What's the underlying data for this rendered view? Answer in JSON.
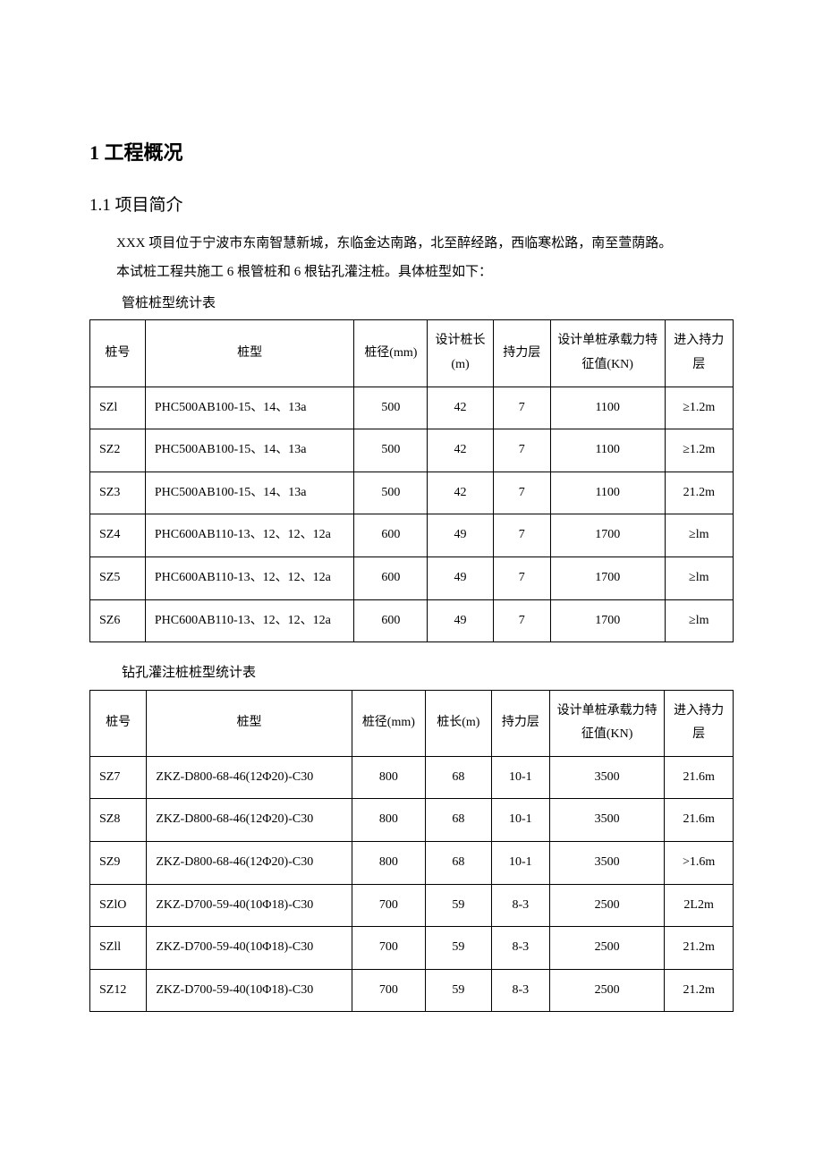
{
  "h1": "1 工程概况",
  "h2": "1.1 项目简介",
  "p1": "XXX 项目位于宁波市东南智慧新城，东临金达南路，北至醉经路，西临寒松路，南至萱荫路。",
  "p2": "本试桩工程共施工 6 根管桩和 6 根钻孔灌注桩。具体桩型如下：",
  "t1_caption": "管桩桩型统计表",
  "t1_head": {
    "c1": "桩号",
    "c2": "桩型",
    "c3": "桩径(mm)",
    "c4": "设计桩长(m)",
    "c5": "持力层",
    "c6": "设计单桩承载力特征值(KN)",
    "c7": "进入持力层"
  },
  "t1_rows": [
    {
      "c1": "SZl",
      "c2": "PHC500AB100-15、14、13a",
      "c3": "500",
      "c4": "42",
      "c5": "7",
      "c6": "1100",
      "c7": "≥1.2m"
    },
    {
      "c1": "SZ2",
      "c2": "PHC500AB100-15、14、13a",
      "c3": "500",
      "c4": "42",
      "c5": "7",
      "c6": "1100",
      "c7": "≥1.2m"
    },
    {
      "c1": "SZ3",
      "c2": "PHC500AB100-15、14、13a",
      "c3": "500",
      "c4": "42",
      "c5": "7",
      "c6": "1100",
      "c7": "21.2m"
    },
    {
      "c1": "SZ4",
      "c2": "PHC600AB110-13、12、12、12a",
      "c3": "600",
      "c4": "49",
      "c5": "7",
      "c6": "1700",
      "c7": "≥lm"
    },
    {
      "c1": "SZ5",
      "c2": "PHC600AB110-13、12、12、12a",
      "c3": "600",
      "c4": "49",
      "c5": "7",
      "c6": "1700",
      "c7": "≥lm"
    },
    {
      "c1": "SZ6",
      "c2": "PHC600AB110-13、12、12、12a",
      "c3": "600",
      "c4": "49",
      "c5": "7",
      "c6": "1700",
      "c7": "≥lm"
    }
  ],
  "t2_caption": "钻孔灌注桩桩型统计表",
  "t2_head": {
    "c1": "桩号",
    "c2": "桩型",
    "c3": "桩径(mm)",
    "c4": "桩长(m)",
    "c5": "持力层",
    "c6": "设计单桩承载力特征值(KN)",
    "c7": "进入持力层"
  },
  "t2_rows": [
    {
      "c1": "SZ7",
      "c2": "ZKZ-D800-68-46(12Φ20)-C30",
      "c3": "800",
      "c4": "68",
      "c5": "10-1",
      "c6": "3500",
      "c7": "21.6m"
    },
    {
      "c1": "SZ8",
      "c2": "ZKZ-D800-68-46(12Φ20)-C30",
      "c3": "800",
      "c4": "68",
      "c5": "10-1",
      "c6": "3500",
      "c7": "21.6m"
    },
    {
      "c1": "SZ9",
      "c2": "ZKZ-D800-68-46(12Φ20)-C30",
      "c3": "800",
      "c4": "68",
      "c5": "10-1",
      "c6": "3500",
      "c7": ">1.6m"
    },
    {
      "c1": "SZlO",
      "c2": "ZKZ-D700-59-40(10Φ18)-C30",
      "c3": "700",
      "c4": "59",
      "c5": "8-3",
      "c6": "2500",
      "c7": "2L2m"
    },
    {
      "c1": "SZll",
      "c2": "ZKZ-D700-59-40(10Φ18)-C30",
      "c3": "700",
      "c4": "59",
      "c5": "8-3",
      "c6": "2500",
      "c7": "21.2m"
    },
    {
      "c1": "SZ12",
      "c2": "ZKZ-D700-59-40(10Φ18)-C30",
      "c3": "700",
      "c4": "59",
      "c5": "8-3",
      "c6": "2500",
      "c7": "21.2m"
    }
  ]
}
